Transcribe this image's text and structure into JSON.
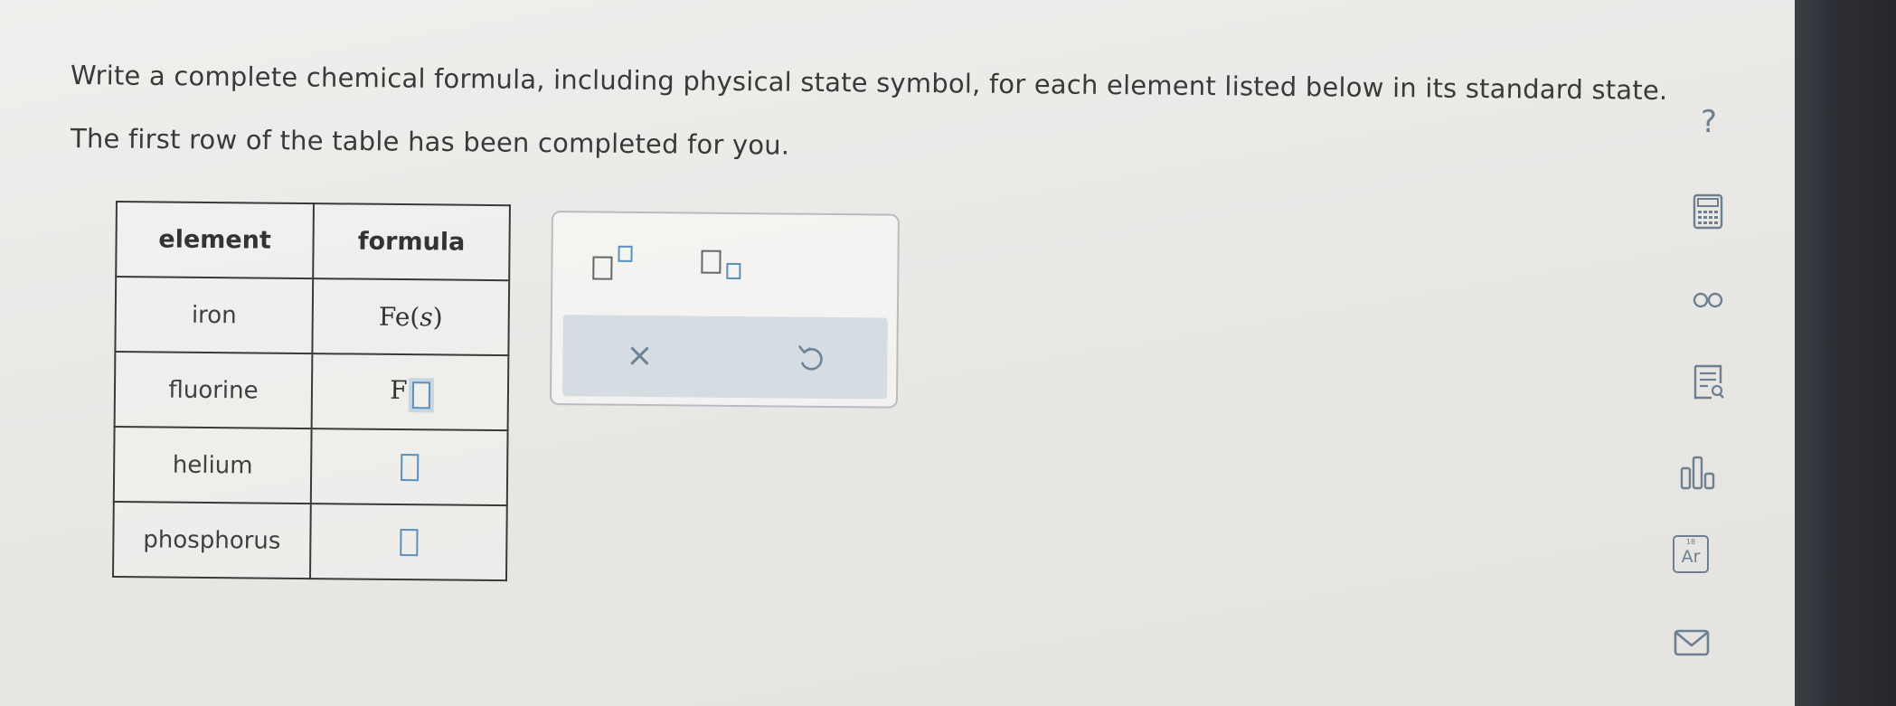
{
  "question": {
    "line1": "Write a complete chemical formula, including physical state symbol, for each element listed below in its standard state.",
    "line2": "The first row of the table has been completed for you."
  },
  "help_label": "?",
  "table": {
    "headers": [
      "element",
      "formula"
    ],
    "rows": [
      {
        "element": "iron",
        "formula_symbol": "Fe",
        "formula_state": "s"
      },
      {
        "element": "fluorine",
        "formula_symbol": "F",
        "formula_state": ""
      },
      {
        "element": "helium",
        "formula_symbol": "",
        "formula_state": ""
      },
      {
        "element": "phosphorus",
        "formula_symbol": "",
        "formula_state": ""
      }
    ]
  },
  "palette": {
    "tools": [
      "superscript",
      "subscript"
    ],
    "clear_label": "×"
  },
  "sidebar": {
    "tools": [
      "calculator-icon",
      "reference-icon",
      "data-icon",
      "chart-icon",
      "periodic-table-icon",
      "mail-icon"
    ],
    "periodic_symbol": "Ar",
    "periodic_number": "18"
  },
  "colors": {
    "accent": "#5a8fbf",
    "icon": "#6d7f90",
    "text": "#3a3a3a"
  }
}
